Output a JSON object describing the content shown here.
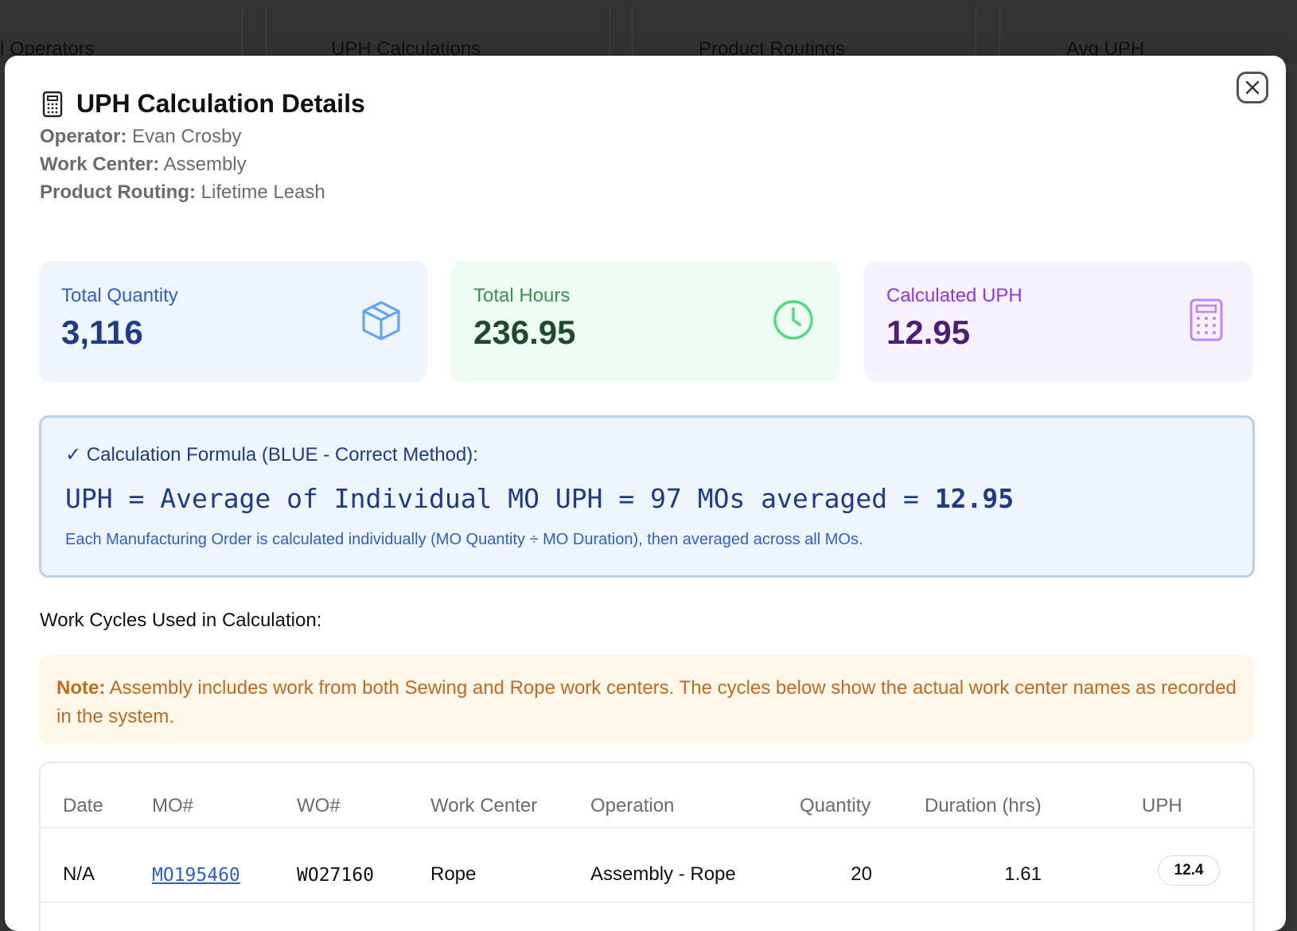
{
  "background": {
    "columns": [
      "l Operators",
      "UPH Calculations",
      "Product Routings",
      "Avg UPH"
    ]
  },
  "modal": {
    "title": "UPH Calculation Details",
    "title_icon": "calculator-icon",
    "close_icon": "close-icon",
    "meta": [
      {
        "label": "Operator:",
        "value": "Evan Crosby"
      },
      {
        "label": "Work Center:",
        "value": "Assembly"
      },
      {
        "label": "Product Routing:",
        "value": "Lifetime Leash"
      }
    ]
  },
  "stats": [
    {
      "label": "Total Quantity",
      "value": "3,116",
      "icon": "package-icon",
      "color": "#3b82f6"
    },
    {
      "label": "Total Hours",
      "value": "236.95",
      "icon": "clock-icon",
      "color": "#4ade80"
    },
    {
      "label": "Calculated UPH",
      "value": "12.95",
      "icon": "calculator-icon",
      "color": "#c084fc"
    }
  ],
  "formula": {
    "heading": "✓ Calculation Formula (BLUE - Correct Method):",
    "equation_prefix": "UPH = Average of Individual MO UPH = 97 MOs averaged = ",
    "equation_result": "12.95",
    "description": "Each Manufacturing Order is calculated individually (MO Quantity ÷ MO Duration), then averaged across all MOs."
  },
  "work_cycles": {
    "title": "Work Cycles Used in Calculation:",
    "note_label": "Note:",
    "note_text": " Assembly includes work from both Sewing and Rope work centers. The cycles below show the actual work center names as recorded in the system."
  },
  "table": {
    "headers": [
      "Date",
      "MO#",
      "WO#",
      "Work Center",
      "Operation",
      "Quantity",
      "Duration (hrs)",
      "UPH"
    ],
    "rows": [
      {
        "date": "N/A",
        "mo": "MO195460",
        "wo": "WO27160",
        "work_center": "Rope",
        "operation": "Assembly - Rope",
        "quantity": "20",
        "duration": "1.61",
        "uph": "12.4"
      }
    ]
  }
}
